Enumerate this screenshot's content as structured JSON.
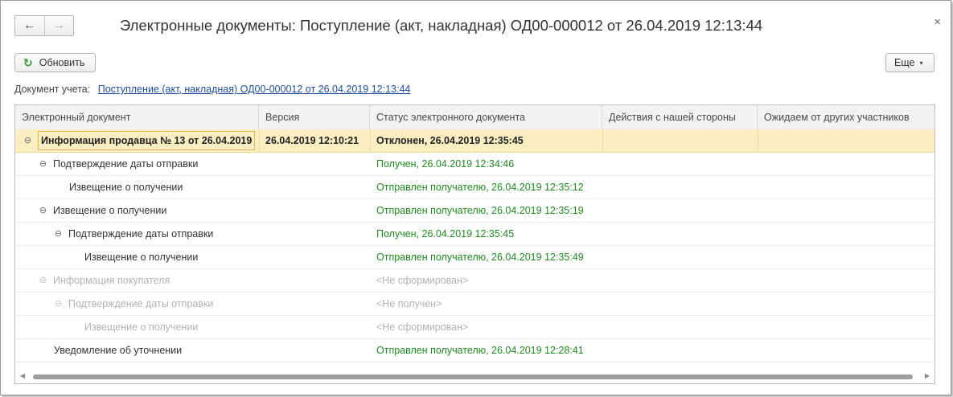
{
  "window": {
    "title": "Электронные документы: Поступление (акт, накладная) ОД00-000012 от 26.04.2019 12:13:44",
    "back_icon": "←",
    "forward_icon": "→",
    "close_icon": "×"
  },
  "toolbar": {
    "refresh_icon": "↻",
    "refresh_label": "Обновить",
    "more_label": "Еще",
    "more_caret": "▾"
  },
  "doc": {
    "label": "Документ учета:",
    "link": "Поступление (акт, накладная) ОД00-000012 от 26.04.2019 12:13:44"
  },
  "table": {
    "columns": [
      "Электронный документ",
      "Версия",
      "Статус электронного документа",
      "Действия с нашей стороны",
      "Ожидаем от других участников"
    ],
    "rows": [
      {
        "toggle": "⊖",
        "name": "Информация продавца № 13 от 26.04.2019",
        "version": "26.04.2019 12:10:21",
        "status": "Отклонен, 26.04.2019 12:35:45",
        "actions": "",
        "waiting": ""
      },
      {
        "toggle": "⊖",
        "name": "Подтверждение даты отправки",
        "version": "",
        "status": "Получен, 26.04.2019 12:34:46",
        "actions": "",
        "waiting": ""
      },
      {
        "toggle": "",
        "name": "Извещение о получении",
        "version": "",
        "status": "Отправлен получателю, 26.04.2019 12:35:12",
        "actions": "",
        "waiting": ""
      },
      {
        "toggle": "⊖",
        "name": "Извещение о получении",
        "version": "",
        "status": "Отправлен получателю, 26.04.2019 12:35:19",
        "actions": "",
        "waiting": ""
      },
      {
        "toggle": "⊖",
        "name": "Подтверждение даты отправки",
        "version": "",
        "status": "Получен, 26.04.2019 12:35:45",
        "actions": "",
        "waiting": ""
      },
      {
        "toggle": "",
        "name": "Извещение о получении",
        "version": "",
        "status": "Отправлен получателю, 26.04.2019 12:35:49",
        "actions": "",
        "waiting": ""
      },
      {
        "toggle": "⊖",
        "name": "Информация покупателя",
        "version": "",
        "status": "<Не сформирован>",
        "actions": "",
        "waiting": ""
      },
      {
        "toggle": "⊖",
        "name": "Подтверждение даты отправки",
        "version": "",
        "status": "<Не получен>",
        "actions": "",
        "waiting": ""
      },
      {
        "toggle": "",
        "name": "Извещение о получении",
        "version": "",
        "status": "<Не сформирован>",
        "actions": "",
        "waiting": ""
      },
      {
        "toggle": "",
        "name": "Уведомление об уточнении",
        "version": "",
        "status": "Отправлен получателю, 26.04.2019 12:28:41",
        "actions": "",
        "waiting": ""
      }
    ]
  },
  "scroll": {
    "left_icon": "◀",
    "right_icon": "▶"
  },
  "colors": {
    "status_ok": "#1f8a1f",
    "selected_row": "#fbeec2",
    "link": "#1c4e9c"
  }
}
